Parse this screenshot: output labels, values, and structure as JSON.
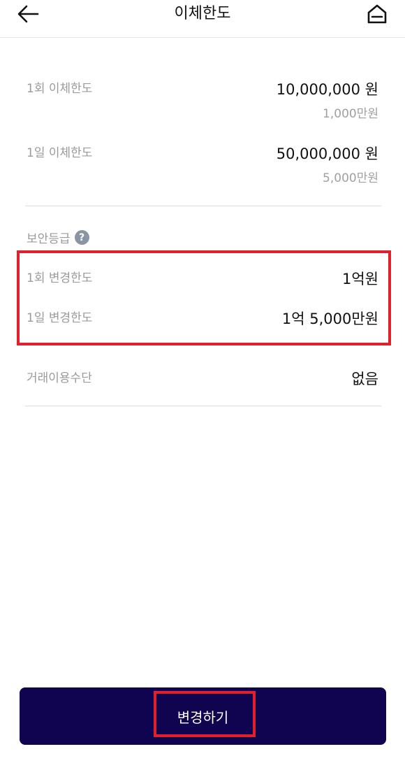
{
  "header": {
    "title": "이체한도",
    "back_icon": "arrow-left-icon",
    "home_icon": "home-icon"
  },
  "limits": {
    "per_transaction": {
      "label": "1회 이체한도",
      "value": "10,000,000 원",
      "sub": "1,000만원"
    },
    "per_day": {
      "label": "1일 이체한도",
      "value": "50,000,000 원",
      "sub": "5,000만원"
    }
  },
  "security": {
    "label": "보안등급",
    "help_icon": "question-icon",
    "per_transaction_change": {
      "label": "1회 변경한도",
      "value": "1억원"
    },
    "per_day_change": {
      "label": "1일 변경한도",
      "value": "1억 5,000만원"
    }
  },
  "method": {
    "label": "거래이용수단",
    "value": "없음"
  },
  "cta": {
    "label": "변경하기"
  },
  "colors": {
    "primary": "#10034f",
    "highlight": "#e0202a",
    "label_gray": "#9a9a9a"
  }
}
